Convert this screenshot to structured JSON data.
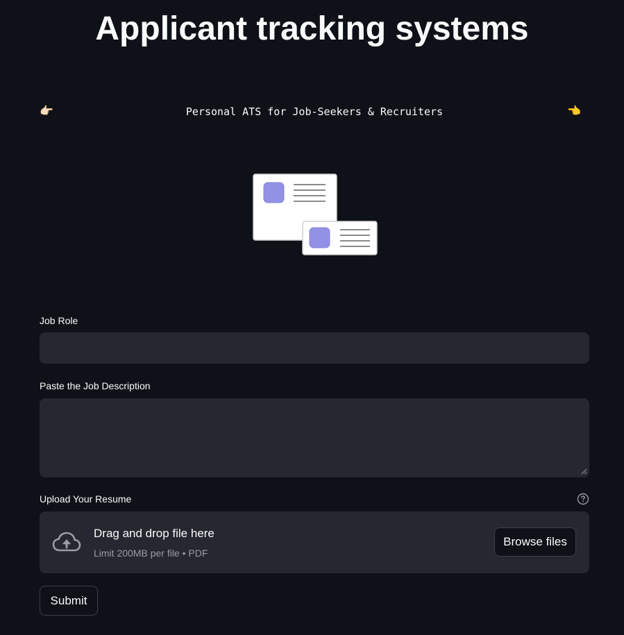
{
  "page": {
    "title": "Applicant tracking systems",
    "tagline": "Personal ATS for Job-Seekers & Recruiters",
    "tagline_left_emoji": "👉🏻",
    "tagline_right_emoji": "👈"
  },
  "hero": {
    "icon": "id-cards-illustration"
  },
  "form": {
    "job_role": {
      "label": "Job Role",
      "value": "",
      "placeholder": ""
    },
    "job_description": {
      "label": "Paste the Job Description",
      "value": "",
      "placeholder": ""
    },
    "resume_upload": {
      "label": "Upload Your Resume",
      "help_icon": "question-circle-icon",
      "dropzone_title": "Drag and drop file here",
      "dropzone_subtitle": "Limit 200MB per file • PDF",
      "browse_label": "Browse files",
      "icon": "cloud-upload-icon"
    },
    "submit_label": "Submit"
  },
  "colors": {
    "background": "#0e1117",
    "input_background": "#262730",
    "text": "#fafafa",
    "muted_text": "#9a9da6",
    "accent_illustration": "#9391e6"
  }
}
